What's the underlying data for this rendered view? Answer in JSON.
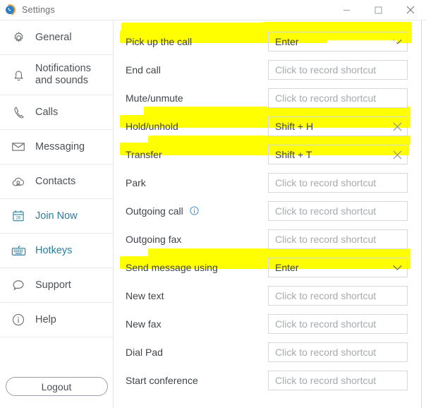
{
  "window": {
    "title": "Settings",
    "app_icon": "phone-circle-icon",
    "minimize_label": "Minimize",
    "maximize_label": "Maximize",
    "close_label": "Close"
  },
  "sidebar": {
    "items": [
      {
        "label": "General",
        "icon": "gear-icon",
        "active": false
      },
      {
        "label": "Notifications and sounds",
        "icon": "bell-icon",
        "active": false
      },
      {
        "label": "Calls",
        "icon": "phone-icon",
        "active": false
      },
      {
        "label": "Messaging",
        "icon": "envelope-icon",
        "active": false
      },
      {
        "label": "Contacts",
        "icon": "cloud-contacts-icon",
        "active": false
      },
      {
        "label": "Join Now",
        "icon": "calendar-26-icon",
        "active": false
      },
      {
        "label": "Hotkeys",
        "icon": "keyboard-icon",
        "active": true
      },
      {
        "label": "Support",
        "icon": "chat-bubble-icon",
        "active": false
      },
      {
        "label": "Help",
        "icon": "info-circle-icon",
        "active": false
      }
    ],
    "logout_label": "Logout",
    "active_color": "#2a7d9c"
  },
  "hotkeys": {
    "placeholder": "Click to record shortcut",
    "rows": [
      {
        "label": "Pick up the call",
        "control": "dropdown",
        "value": "Enter",
        "highlighted": true,
        "icon": "chevron-down-icon"
      },
      {
        "label": "End call",
        "control": "input",
        "value": "",
        "highlighted": false
      },
      {
        "label": "Mute/unmute",
        "control": "input",
        "value": "",
        "highlighted": false
      },
      {
        "label": "Hold/unhold",
        "control": "shortcut",
        "value": "Shift + H",
        "highlighted": true,
        "icon": "close-icon"
      },
      {
        "label": "Transfer",
        "control": "shortcut",
        "value": "Shift + T",
        "highlighted": true,
        "icon": "close-icon"
      },
      {
        "label": "Park",
        "control": "input",
        "value": "",
        "highlighted": false
      },
      {
        "label": "Outgoing call",
        "control": "input",
        "value": "",
        "highlighted": false,
        "info": true,
        "info_icon": "info-circle-icon"
      },
      {
        "label": "Outgoing fax",
        "control": "input",
        "value": "",
        "highlighted": false
      },
      {
        "label": "Send message using",
        "control": "dropdown",
        "value": "Enter",
        "highlighted": true,
        "icon": "chevron-down-icon"
      },
      {
        "label": "New text",
        "control": "input",
        "value": "",
        "highlighted": false
      },
      {
        "label": "New fax",
        "control": "input",
        "value": "",
        "highlighted": false
      },
      {
        "label": "Dial Pad",
        "control": "input",
        "value": "",
        "highlighted": false
      },
      {
        "label": "Start conference",
        "control": "input",
        "value": "",
        "highlighted": false
      }
    ],
    "highlight_color": "#ffff00"
  }
}
